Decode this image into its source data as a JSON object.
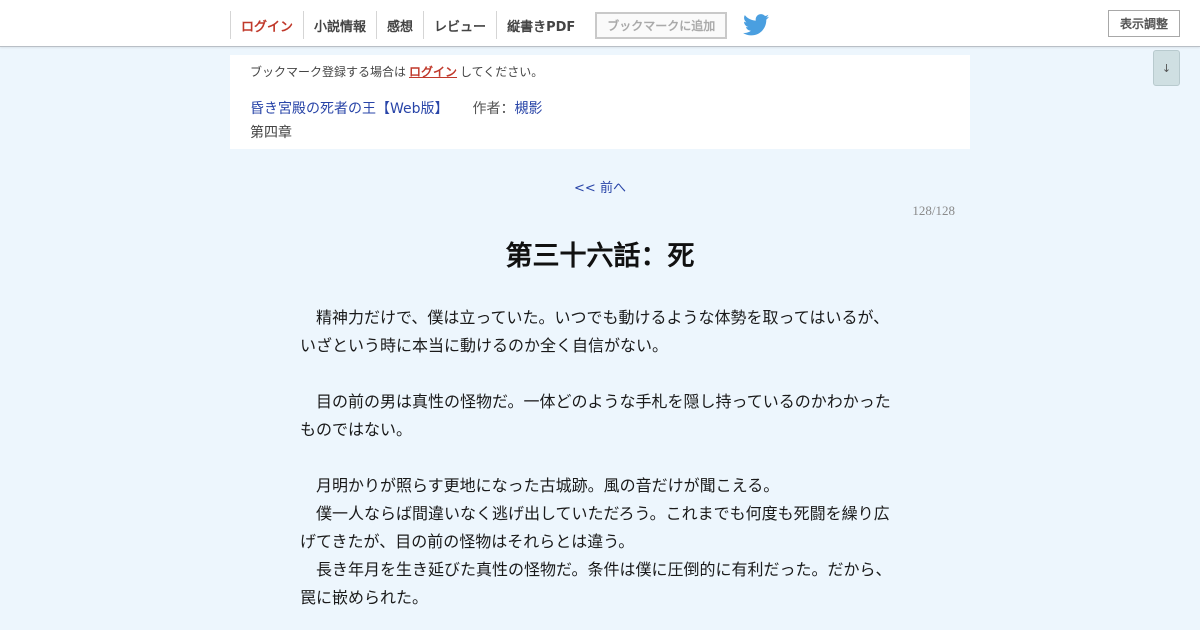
{
  "nav": {
    "items": [
      {
        "label": "ログイン"
      },
      {
        "label": "小説情報"
      },
      {
        "label": "感想"
      },
      {
        "label": "レビュー"
      },
      {
        "label": "縦書きPDF"
      }
    ],
    "bookmark_add": "ブックマークに追加",
    "twitter_icon": "twitter-bird-icon",
    "display_settings": "表示調整",
    "scroll_down": "↓"
  },
  "info": {
    "bookmark_msg_before": "ブックマーク登録する場合は",
    "bookmark_msg_link": "ログイン",
    "bookmark_msg_after": "してください。",
    "novel_title": "昏き宮殿の死者の王【Web版】",
    "author_label": "作者：",
    "author_name": "槻影",
    "chapter": "第四章"
  },
  "navigation": {
    "prev": "<< 前へ",
    "page_counter": "128/128"
  },
  "episode": {
    "title": "第三十六話：死",
    "lines": [
      "　精神力だけで、僕は立っていた。いつでも動けるような体勢を取ってはいるが、",
      "いざという時に本当に動けるのか全く自信がない。",
      "",
      "　目の前の男は真性の怪物だ。一体どのような手札を隠し持っているのかわかった",
      "ものではない。",
      "",
      "　月明かりが照らす更地になった古城跡。風の音だけが聞こえる。",
      "　僕一人ならば間違いなく逃げ出していただろう。これまでも何度も死闘を繰り広",
      "げてきたが、目の前の怪物はそれらとは違う。",
      "　長き年月を生き延びた真性の怪物だ。条件は僕に圧倒的に有利だった。だから、",
      "罠に嵌められた。"
    ]
  },
  "colors": {
    "background": "#edf6fd",
    "link": "#2945a8",
    "login_red": "#c0392b",
    "twitter_blue": "#4a9fe0"
  }
}
